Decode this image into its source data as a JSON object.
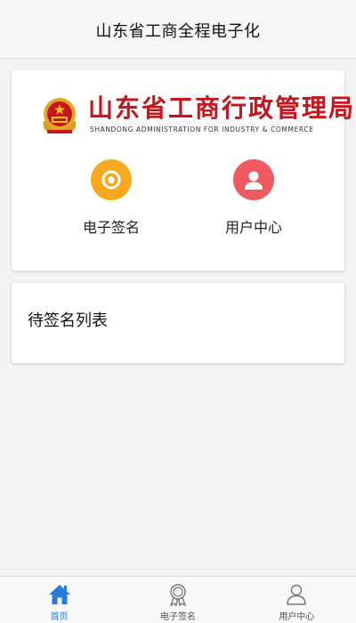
{
  "header": {
    "title": "山东省工商全程电子化"
  },
  "banner": {
    "logo_text": "山东省工商行政管理局",
    "logo_subtitle": "SHANDONG ADMINISTRATION FOR INDUSTRY & COMMERCE"
  },
  "shortcuts": [
    {
      "label": "电子签名",
      "icon": "badge-icon",
      "color": "#f7a81d"
    },
    {
      "label": "用户中心",
      "icon": "user-icon",
      "color": "#ee5a60"
    }
  ],
  "pending_list": {
    "title": "待签名列表"
  },
  "tabbar": {
    "active_color": "#2a7ad8",
    "tabs": [
      {
        "label": "首页",
        "icon": "home-icon",
        "active": true
      },
      {
        "label": "电子签名",
        "icon": "award-icon",
        "active": false
      },
      {
        "label": "用户中心",
        "icon": "person-icon",
        "active": false
      }
    ]
  }
}
